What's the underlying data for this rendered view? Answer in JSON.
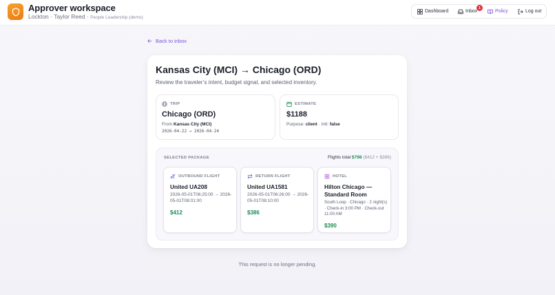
{
  "header": {
    "title": "Approver workspace",
    "org": "Lockton",
    "user": "Taylor Reed",
    "team": "People Leadership (demo)",
    "nav": {
      "dashboard": "Dashboard",
      "inbox": "Inbox",
      "inbox_count": "1",
      "policy": "Policy",
      "logout": "Log out"
    }
  },
  "back_link": "Back to inbox",
  "request": {
    "title": "Kansas City (MCI) → Chicago (ORD)",
    "subtitle": "Review the traveler’s intent, budget signal, and selected inventory."
  },
  "trip": {
    "label": "TRIP",
    "destination": "Chicago (ORD)",
    "from_prefix": "From",
    "origin": "Kansas City (MCI)",
    "dates": "2026-04-22 → 2026-04-24"
  },
  "estimate": {
    "label": "ESTIMATE",
    "amount": "$1188",
    "purpose_label": "Purpose:",
    "purpose": "client",
    "intl_label": "· Intl:",
    "intl": "false"
  },
  "package": {
    "label": "SELECTED PACKAGE",
    "flights_total_label": "Flights total",
    "flights_total": "$798",
    "flights_breakdown": "($412 + $386)",
    "outbound": {
      "label": "OUTBOUND FLIGHT",
      "flight": "United UA208",
      "times": "2026-05-01T06:25:00 → 2026-05-01T08:01:00",
      "price": "$412"
    },
    "return": {
      "label": "RETURN FLIGHT",
      "flight": "United UA1581",
      "times": "2026-05-01T06:26:00 → 2026-05-01T08:10:00",
      "price": "$386"
    },
    "hotel": {
      "label": "HOTEL",
      "name": "Hilton Chicago — Standard Room",
      "details": "South Loop · Chicago · 2 night(s) · Check-in 3:00 PM · Check-out 11:00 AM",
      "price": "$390"
    }
  },
  "status_note": "This request is no longer pending.",
  "colors": {
    "accent": "#7b4fd6",
    "logo": "#ef8a1c",
    "price": "#1e8a55",
    "badge": "#e0323f"
  },
  "icons": [
    "shield-logo",
    "dashboard-icon",
    "inbox-icon",
    "book-icon",
    "logout-icon",
    "arrow-left-icon",
    "globe-icon",
    "calendar-icon",
    "plane-icon",
    "swap-icon",
    "hotel-icon"
  ]
}
